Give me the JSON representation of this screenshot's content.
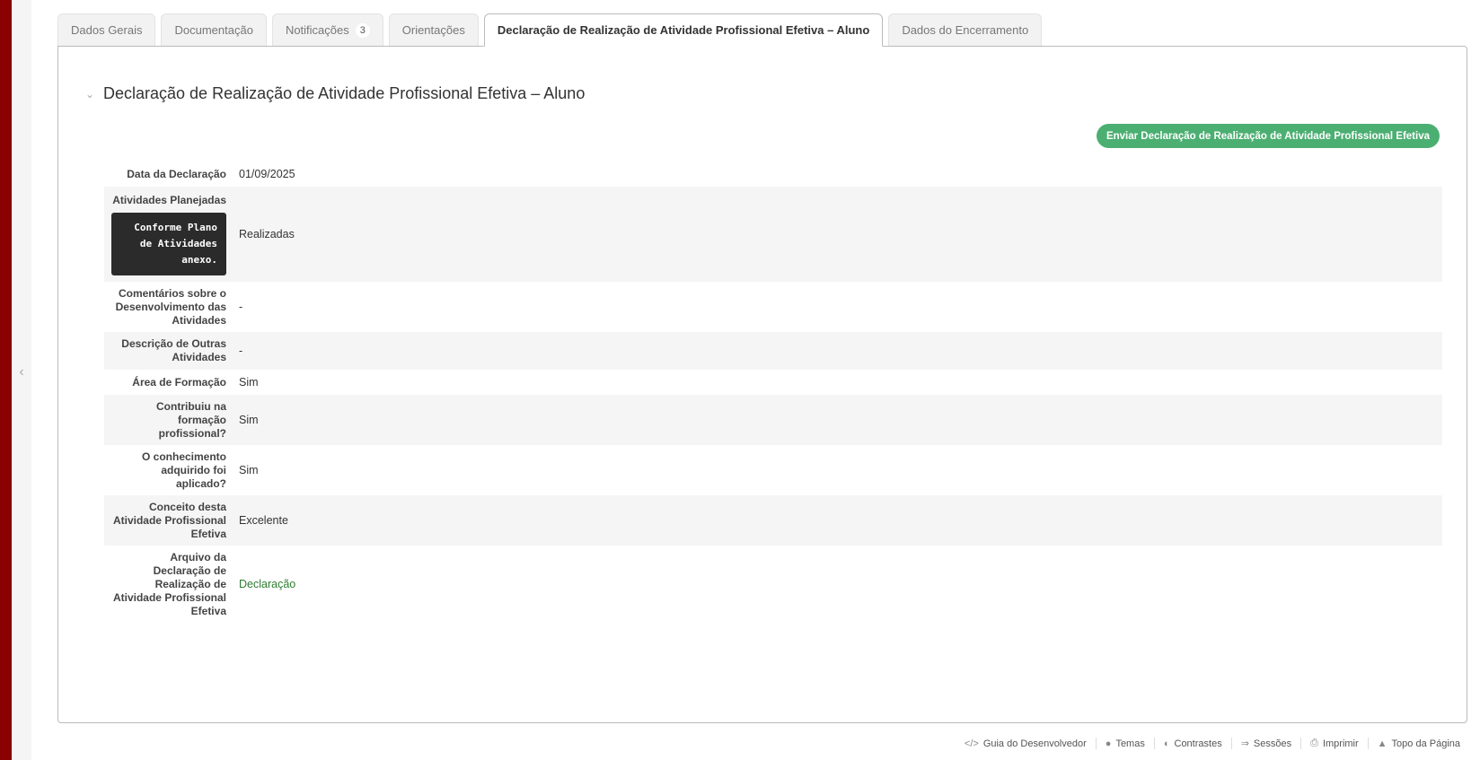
{
  "tabs": [
    {
      "label": "Dados Gerais"
    },
    {
      "label": "Documentação"
    },
    {
      "label": "Notificações",
      "badge": "3"
    },
    {
      "label": "Orientações"
    },
    {
      "label": "Declaração de Realização de Atividade Profissional Efetiva – Aluno",
      "active": true
    },
    {
      "label": "Dados do Encerramento"
    }
  ],
  "section": {
    "title": "Declaração de Realização de Atividade Profissional Efetiva – Aluno",
    "send_button": "Enviar Declaração de Realização de Atividade Profissional Efetiva"
  },
  "fields": {
    "data_declaracao": {
      "label": "Data da Declaração",
      "value": "01/09/2025"
    },
    "atividades_planejadas": {
      "label": "Atividades Planejadas",
      "note": "Conforme Plano de Atividades anexo.",
      "value": "Realizadas"
    },
    "comentarios": {
      "label": "Comentários sobre o Desenvolvimento das Atividades",
      "value": "-"
    },
    "outras_atividades": {
      "label": "Descrição de Outras Atividades",
      "value": "-"
    },
    "area_formacao": {
      "label": "Área de Formação",
      "value": "Sim"
    },
    "contribuiu": {
      "label": "Contribuiu na formação profissional?",
      "value": "Sim"
    },
    "conhecimento": {
      "label": "O conhecimento adquirido foi aplicado?",
      "value": "Sim"
    },
    "conceito": {
      "label": "Conceito desta Atividade Profissional Efetiva",
      "value": "Excelente"
    },
    "arquivo": {
      "label": "Arquivo da Declaração de Realização de Atividade Profissional Efetiva",
      "value": "Declaração"
    }
  },
  "footer": [
    {
      "label": "Guia do Desenvolvedor",
      "icon": "code-icon"
    },
    {
      "label": "Temas",
      "icon": "palette-icon"
    },
    {
      "label": "Contrastes",
      "icon": "contrast-icon"
    },
    {
      "label": "Sessões",
      "icon": "sessions-icon"
    },
    {
      "label": "Imprimir",
      "icon": "print-icon"
    },
    {
      "label": "Topo da Página",
      "icon": "arrow-up-icon"
    }
  ],
  "colors": {
    "accent_bar": "#8b0000",
    "success": "#4caf72",
    "link": "#2e7d32"
  }
}
